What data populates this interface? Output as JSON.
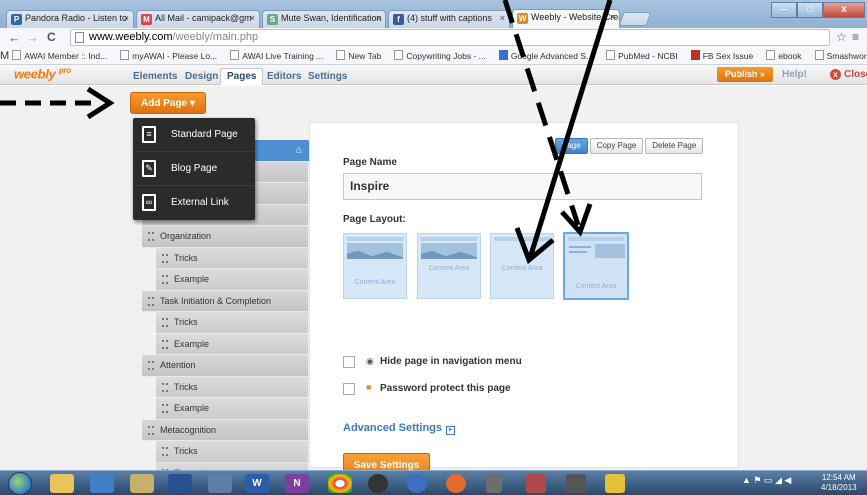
{
  "browser": {
    "tabs": [
      {
        "label": "Pandora Radio - Listen to",
        "favicon": "P",
        "favcolor": "#3668a0"
      },
      {
        "label": "All Mail - camipack@gm",
        "favicon": "M",
        "favcolor": "#d44"
      },
      {
        "label": "Mute Swan, Identification",
        "favicon": "S",
        "favcolor": "#6a8"
      },
      {
        "label": "(4) stuff with captions",
        "favicon": "f",
        "favcolor": "#3b5998"
      },
      {
        "label": "Weebly - Website Creati",
        "favicon": "W",
        "favcolor": "#e88a1a"
      }
    ],
    "close_glyph": "×",
    "back_glyph": "←",
    "forward_glyph": "→",
    "reload_glyph": "C",
    "url_host": "www.weebly.com",
    "url_path": "/weebly/main.php",
    "star_glyph": "☆",
    "menu_glyph": "≡",
    "window_buttons": [
      "–",
      "□",
      "x"
    ],
    "bookmarks": [
      "AWAI Member :: Ind...",
      "myAWAI - Please Lo...",
      "AWAI Live Training ...",
      "New Tab",
      "Copywriting Jobs - ...",
      "Google Advanced S...",
      "PubMed - NCBI",
      "FB Sex Issue",
      "ebook",
      "Smashwords — Ebo..."
    ]
  },
  "app": {
    "logo": "weebly",
    "logo_badge": "pro",
    "tabs": [
      "Elements",
      "Design",
      "Pages",
      "Editors",
      "Settings"
    ],
    "selected_tab": "Pages",
    "publish_label": "Publish »",
    "help_label": "Help!",
    "close_label": "Close",
    "close_glyph": "x"
  },
  "add_page": {
    "label": "Add Page ▾",
    "menu": [
      "Standard Page",
      "Blog Page",
      "External Link"
    ]
  },
  "page_list": [
    {
      "label": "",
      "level": 0,
      "home": true
    },
    {
      "label": "",
      "level": 0
    },
    {
      "label": "",
      "level": 0
    },
    {
      "label": "",
      "level": 0
    },
    {
      "label": "Organization",
      "level": 0
    },
    {
      "label": "Tricks",
      "level": 1
    },
    {
      "label": "Example",
      "level": 1
    },
    {
      "label": "Task Initiation & Completion",
      "level": 0
    },
    {
      "label": "Tricks",
      "level": 1
    },
    {
      "label": "Example",
      "level": 1
    },
    {
      "label": "Attention",
      "level": 0
    },
    {
      "label": "Tricks",
      "level": 1
    },
    {
      "label": "Example",
      "level": 1
    },
    {
      "label": "Metacognition",
      "level": 0
    },
    {
      "label": "Tricks",
      "level": 1
    },
    {
      "label": "Example",
      "level": 1
    }
  ],
  "home_icon": "⌂",
  "settings": {
    "buttons": [
      "Edit Page",
      "Copy Page",
      "Delete Page"
    ],
    "edit_visible": "Page",
    "page_name_label": "Page Name",
    "page_name_value": "Inspire",
    "layout_label": "Page Layout:",
    "layout_caption": "Content Area",
    "hide_label": "Hide page in navigation menu",
    "password_label": "Password protect this page",
    "advanced_label": "Advanced Settings",
    "advanced_glyph": "▸",
    "save_label": "Save Settings"
  },
  "taskbar": {
    "clock_time": "12:54 AM",
    "clock_date": "4/18/2013",
    "apps": [
      "W",
      "N"
    ]
  }
}
